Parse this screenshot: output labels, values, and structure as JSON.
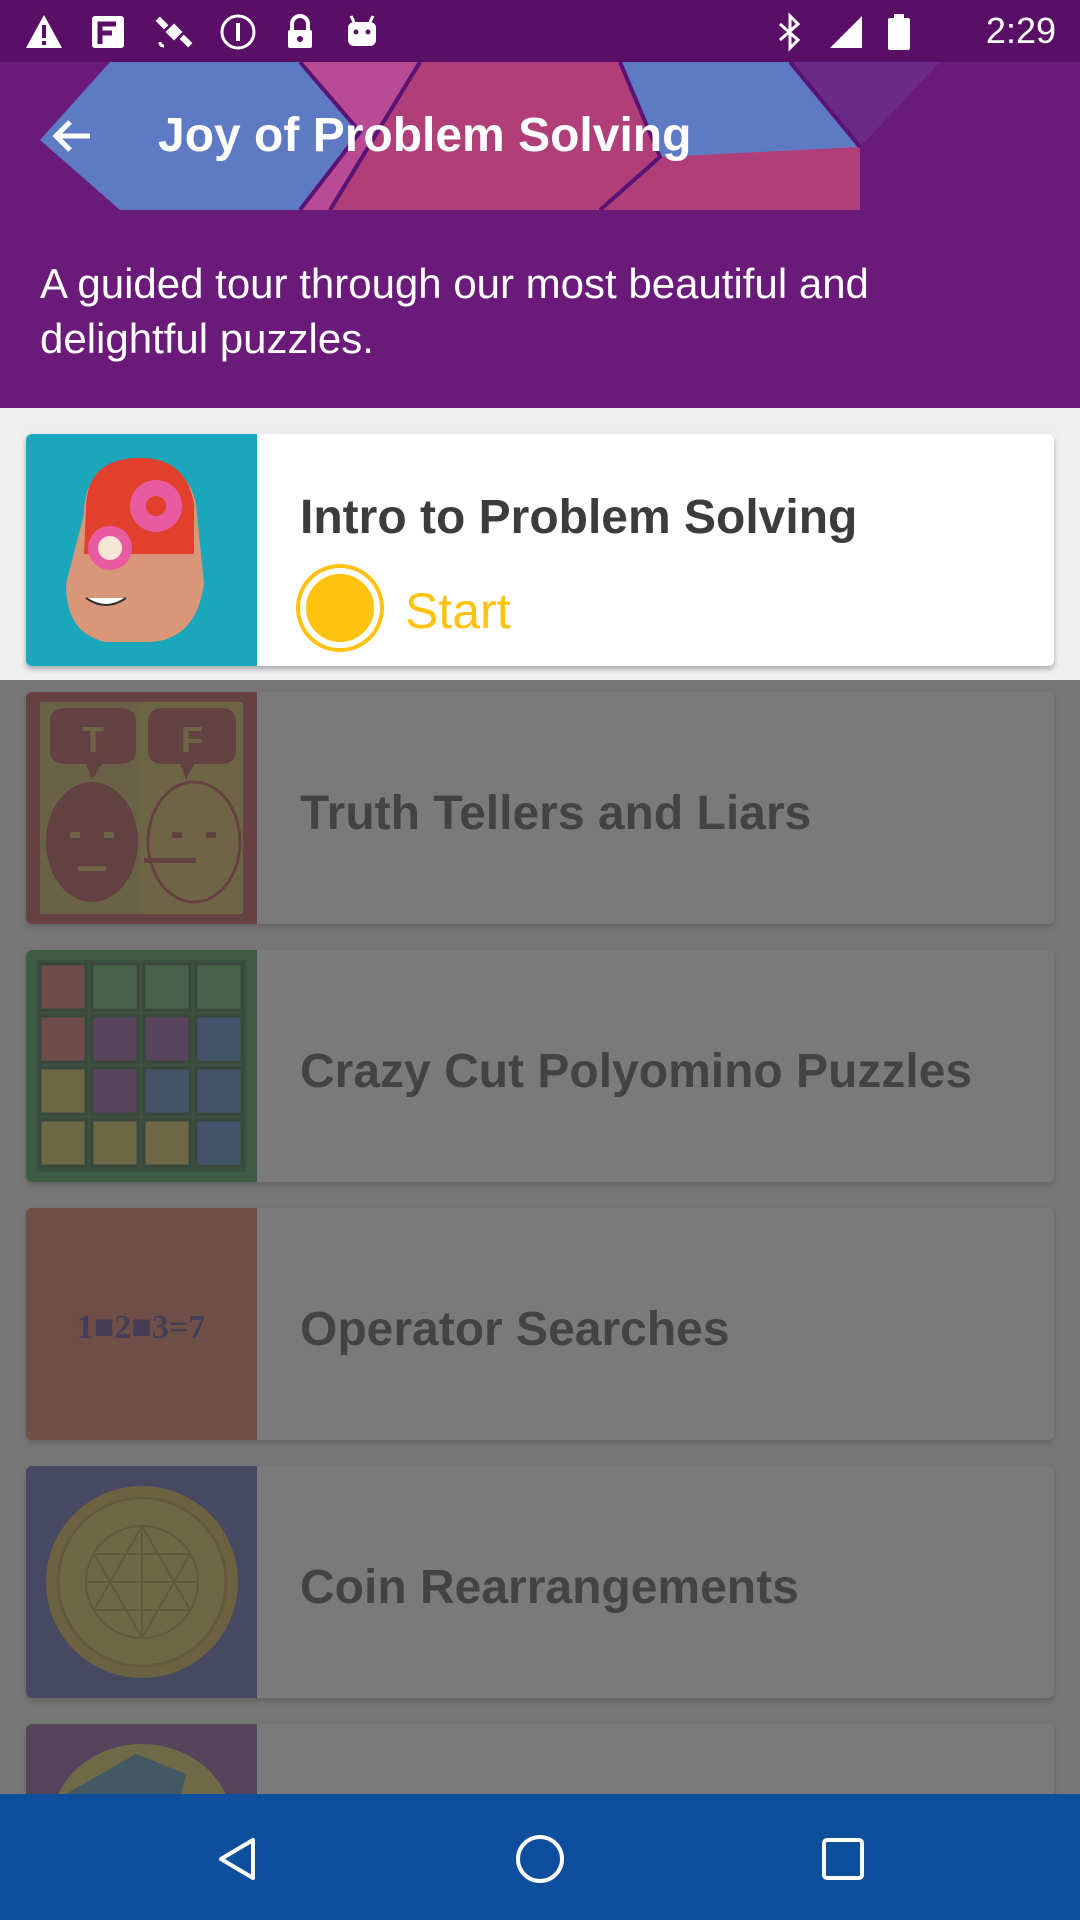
{
  "status_bar": {
    "time": "2:29",
    "left_icons": [
      "warning-icon",
      "fake-gps-icon",
      "satellite-icon",
      "info-icon",
      "lock-icon",
      "android-icon"
    ],
    "right_icons": [
      "bluetooth-icon",
      "signal-icon",
      "battery-icon"
    ]
  },
  "header": {
    "title": "Joy of Problem Solving",
    "back_icon": "arrow-back-icon",
    "description": "A guided tour through our most beautiful and delightful puzzles."
  },
  "courses": [
    {
      "title": "Intro to Problem Solving",
      "status": "Start",
      "active": true
    },
    {
      "title": "Truth Tellers and Liars",
      "active": false
    },
    {
      "title": "Crazy Cut Polyomino Puzzles",
      "active": false
    },
    {
      "title": "Operator Searches",
      "active": false,
      "thumb_text": "1■2■3=7"
    },
    {
      "title": "Coin Rearrangements",
      "active": false
    },
    {
      "title": "",
      "active": false
    }
  ],
  "thumb_letters": {
    "truth": "T",
    "false": "F"
  },
  "nav": [
    "back-triangle-icon",
    "home-circle-icon",
    "recents-square-icon"
  ],
  "colors": {
    "header_purple": "#6a1a78",
    "status_purple": "#5a0f66",
    "accent_yellow": "#ffc20e",
    "nav_blue": "#0d4f9c"
  }
}
